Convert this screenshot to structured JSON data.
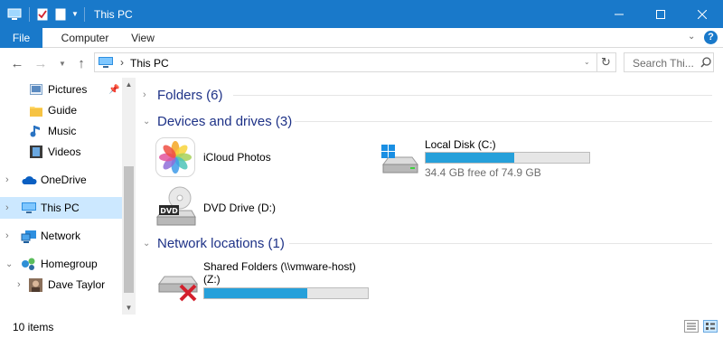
{
  "window": {
    "title": "This PC",
    "controls": {
      "minimize": "minimize-icon",
      "maximize": "maximize-icon",
      "close": "close-icon"
    }
  },
  "ribbon": {
    "tabs": [
      {
        "label": "File"
      },
      {
        "label": "Computer"
      },
      {
        "label": "View"
      }
    ]
  },
  "address": {
    "location": "This PC",
    "search_placeholder": "Search Thi..."
  },
  "navpane": {
    "items": [
      {
        "label": "Pictures",
        "icon": "pictures-folder-icon",
        "pinned": true
      },
      {
        "label": "Guide",
        "icon": "folder-icon"
      },
      {
        "label": "Music",
        "icon": "music-icon"
      },
      {
        "label": "Videos",
        "icon": "videos-icon"
      },
      {
        "label": "OneDrive",
        "icon": "onedrive-icon"
      },
      {
        "label": "This PC",
        "icon": "this-pc-icon",
        "selected": true
      },
      {
        "label": "Network",
        "icon": "network-icon"
      },
      {
        "label": "Homegroup",
        "icon": "homegroup-icon"
      },
      {
        "label": "Dave Taylor",
        "icon": "user-avatar-icon"
      }
    ]
  },
  "content": {
    "groups": [
      {
        "label": "Folders (6)"
      },
      {
        "label": "Devices and drives (3)"
      },
      {
        "label": "Network locations (1)"
      }
    ],
    "devices": [
      {
        "name": "iCloud Photos",
        "icon": "icloud-photos-icon"
      },
      {
        "name": "Local Disk (C:)",
        "free": "34.4 GB free of 74.9 GB",
        "used_fraction": 0.54,
        "icon": "local-disk-icon"
      },
      {
        "name": "DVD Drive (D:)",
        "icon": "dvd-drive-icon"
      }
    ],
    "network": [
      {
        "name": "Shared Folders (\\\\vmware-host)",
        "name2": "(Z:)",
        "used_fraction": 0.63,
        "icon": "network-drive-disconnected-icon"
      }
    ]
  },
  "status": {
    "text": "10 items"
  },
  "colors": {
    "accent": "#1979ca",
    "selection": "#cce8ff",
    "bar_fill": "#26a0da",
    "group_header": "#1e3287"
  }
}
